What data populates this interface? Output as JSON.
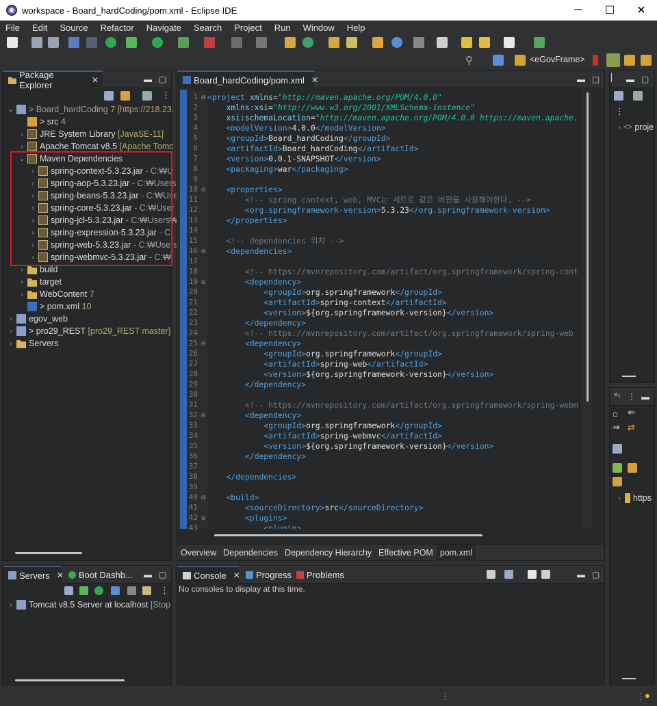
{
  "window": {
    "title": "workspace - Board_hardCoding/pom.xml - Eclipse IDE",
    "minimize": "─",
    "maximize": "☐",
    "close": "✕"
  },
  "menu": [
    "File",
    "Edit",
    "Source",
    "Refactor",
    "Navigate",
    "Search",
    "Project",
    "Run",
    "Window",
    "Help"
  ],
  "perspective": {
    "label": "<eGovFrame>"
  },
  "packageExplorer": {
    "tab": "Package Explorer",
    "items": [
      {
        "label": "> Board_hardCoding",
        "suffix": "7 [https://218.23.",
        "depth": 0,
        "expanded": true
      },
      {
        "label": "> src",
        "suffix": "4",
        "depth": 1,
        "expanded": false
      },
      {
        "label": "JRE System Library",
        "suffix": "[JavaSE-11]",
        "depth": 1,
        "expanded": false
      },
      {
        "label": "Apache Tomcat v8.5",
        "suffix": "[Apache Tomc",
        "depth": 1,
        "expanded": false
      },
      {
        "label": "Maven Dependencies",
        "suffix": "",
        "depth": 1,
        "expanded": true
      },
      {
        "label": "spring-context-5.3.23.jar",
        "suffix": "- C:₩U",
        "depth": 2
      },
      {
        "label": "spring-aop-5.3.23.jar",
        "suffix": "- C:₩Users",
        "depth": 2
      },
      {
        "label": "spring-beans-5.3.23.jar",
        "suffix": "- C:₩Use",
        "depth": 2
      },
      {
        "label": "spring-core-5.3.23.jar",
        "suffix": "- C:₩User",
        "depth": 2
      },
      {
        "label": "spring-jcl-5.3.23.jar",
        "suffix": "- C:₩Users₩",
        "depth": 2
      },
      {
        "label": "spring-expression-5.3.23.jar",
        "suffix": "- C:",
        "depth": 2
      },
      {
        "label": "spring-web-5.3.23.jar",
        "suffix": "- C:₩Users",
        "depth": 2
      },
      {
        "label": "spring-webmvc-5.3.23.jar",
        "suffix": "- C:₩",
        "depth": 2
      },
      {
        "label": "build",
        "suffix": "",
        "depth": 1
      },
      {
        "label": "target",
        "suffix": "",
        "depth": 1
      },
      {
        "label": "WebContent",
        "suffix": "7",
        "depth": 1
      },
      {
        "label": "> pom.xml",
        "suffix": "10",
        "depth": 1
      },
      {
        "label": "egov_web",
        "suffix": "",
        "depth": 0
      },
      {
        "label": "> pro29_REST",
        "suffix": "[pro29_REST master]",
        "depth": 0
      },
      {
        "label": "Servers",
        "suffix": "",
        "depth": 0
      }
    ]
  },
  "editor": {
    "tab": "Board_hardCoding/pom.xml",
    "bottomTabs": [
      "Overview",
      "Dependencies",
      "Dependency Hierarchy",
      "Effective POM",
      "pom.xml"
    ],
    "lines": [
      "<project xmlns=\"http://maven.apache.org/POM/4.0.0\"",
      "    xmlns:xsi=\"http://www.w3.org/2001/XMLSchema-instance\"",
      "    xsi:schemaLocation=\"http://maven.apache.org/POM/4.0.0 https://maven.apache.",
      "    <modelVersion>4.0.0</modelVersion>",
      "    <groupId>Board_hardCoding</groupId>",
      "    <artifactId>Board_hardCoding</artifactId>",
      "    <version>0.0.1-SNAPSHOT</version>",
      "    <packaging>war</packaging>",
      "",
      "    <properties>",
      "        <!-- spring context, web, MVC는 세트로 같은 버전을 사용해야한다. -->",
      "        <org.springframework-version>5.3.23</org.springframework-version>",
      "    </properties>",
      "",
      "    <!-- dependencies 위치 -->",
      "    <dependencies>",
      "",
      "        <!-- https://mvnrepository.com/artifact/org.springframework/spring-cont",
      "        <dependency>",
      "            <groupId>org.springframework</groupId>",
      "            <artifactId>spring-context</artifactId>",
      "            <version>${org.springframework-version}</version>",
      "        </dependency>",
      "        <!-- https://mvnrepository.com/artifact/org.springframework/spring-web",
      "        <dependency>",
      "            <groupId>org.springframework</groupId>",
      "            <artifactId>spring-web</artifactId>",
      "            <version>${org.springframework-version}</version>",
      "        </dependency>",
      "",
      "        <!-- https://mvnrepository.com/artifact/org.springframework/spring-webm",
      "        <dependency>",
      "            <groupId>org.springframework</groupId>",
      "            <artifactId>spring-webmvc</artifactId>",
      "            <version>${org.springframework-version}</version>",
      "        </dependency>",
      "",
      "    </dependencies>",
      "",
      "    <build>",
      "        <sourceDirectory>src</sourceDirectory>",
      "        <plugins>",
      "            <plugin>"
    ],
    "foldLines": [
      1,
      10,
      16,
      19,
      25,
      32,
      40,
      42
    ]
  },
  "servers": {
    "tab": "Servers",
    "tab2": "Boot Dashb...",
    "item": "Tomcat v8.5 Server at localhost",
    "itemSuffix": "[Stop"
  },
  "console": {
    "tab": "Console",
    "tab2": "Progress",
    "tab3": "Problems",
    "message": "No consoles to display at this time."
  },
  "outline": {
    "item": "proje"
  },
  "rightBottom": {
    "item": "https"
  }
}
